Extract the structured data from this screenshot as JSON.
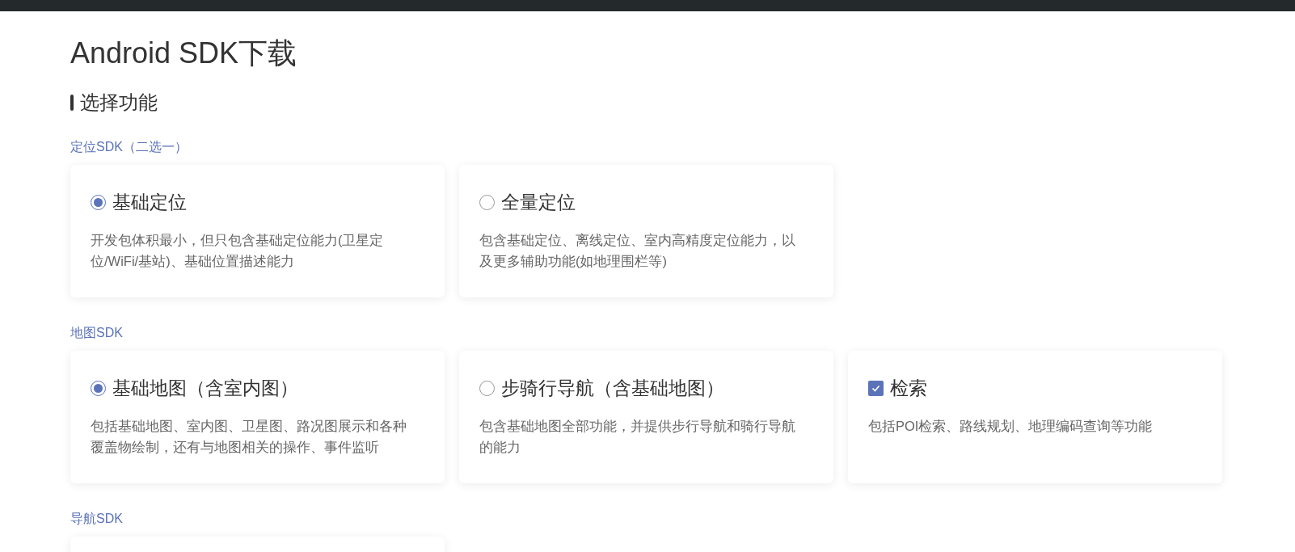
{
  "title": "Android SDK下载",
  "section": "选择功能",
  "groups": [
    {
      "label": "定位SDK（二选一）",
      "items": [
        {
          "kind": "radio",
          "selected": true,
          "name": "基础定位",
          "description": "开发包体积最小，但只包含基础定位能力(卫星定位/WiFi/基站)、基础位置描述能力"
        },
        {
          "kind": "radio",
          "selected": false,
          "name": "全量定位",
          "description": "包含基础定位、离线定位、室内高精度定位能力，以及更多辅助功能(如地理围栏等)"
        }
      ]
    },
    {
      "label": "地图SDK",
      "items": [
        {
          "kind": "radio",
          "selected": true,
          "name": "基础地图（含室内图）",
          "description": "包括基础地图、室内图、卫星图、路况图展示和各种覆盖物绘制，还有与地图相关的操作、事件监听"
        },
        {
          "kind": "radio",
          "selected": false,
          "name": "步骑行导航（含基础地图）",
          "description": "包含基础地图全部功能，并提供步行导航和骑行导航的能力"
        },
        {
          "kind": "checkbox",
          "checked": true,
          "name": "检索",
          "description": "包括POI检索、路线规划、地理编码查询等功能"
        }
      ]
    },
    {
      "label": "导航SDK",
      "items": [
        {
          "kind": "cut"
        }
      ]
    }
  ]
}
